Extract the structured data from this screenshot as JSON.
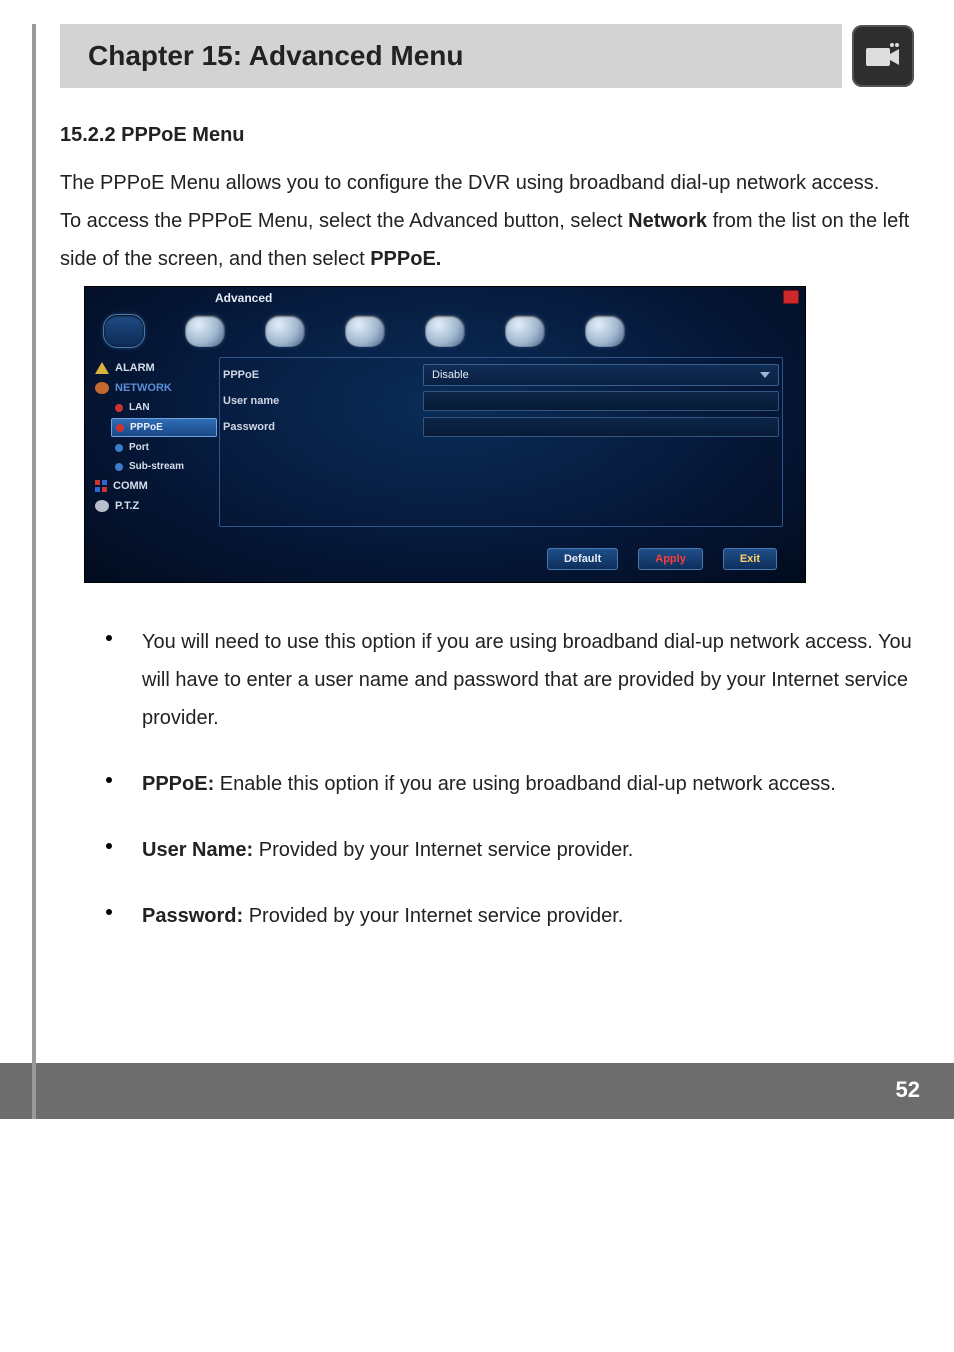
{
  "chapter_title": "Chapter 15: Advanced Menu",
  "section_title": "15.2.2 PPPoE Menu",
  "para1": "The PPPoE Menu allows you to configure the DVR using broadband dial-up network access.",
  "para2_pre": "To access the PPPoE Menu, select the Advanced button, select ",
  "para2_bold1": "Network",
  "para2_mid": " from the list on the left side of the screen, and then select ",
  "para2_bold2": "PPPoE.",
  "bullets": {
    "b1": "You will need to use this option if you are using broadband dial-up network access. You will have to enter a user name and password that are provided by your Internet service provider.",
    "b2_label": "PPPoE:",
    "b2_text": " Enable this option if you are using broadband dial-up network access.",
    "b3_label": "User Name:",
    "b3_text": " Provided by your Internet service provider.",
    "b4_label": "Password:",
    "b4_text": " Provided by your Internet service provider."
  },
  "page_number": "52",
  "dvr": {
    "window_title": "Advanced",
    "sidebar": {
      "alarm": "ALARM",
      "network": "NETWORK",
      "lan": "LAN",
      "pppoe": "PPPoE",
      "port": "Port",
      "substream": "Sub-stream",
      "comm": "COMM",
      "ptz": "P.T.Z"
    },
    "form": {
      "pppoe_label": "PPPoE",
      "pppoe_value": "Disable",
      "username_label": "User name",
      "password_label": "Password"
    },
    "buttons": {
      "default": "Default",
      "apply": "Apply",
      "exit": "Exit"
    }
  }
}
